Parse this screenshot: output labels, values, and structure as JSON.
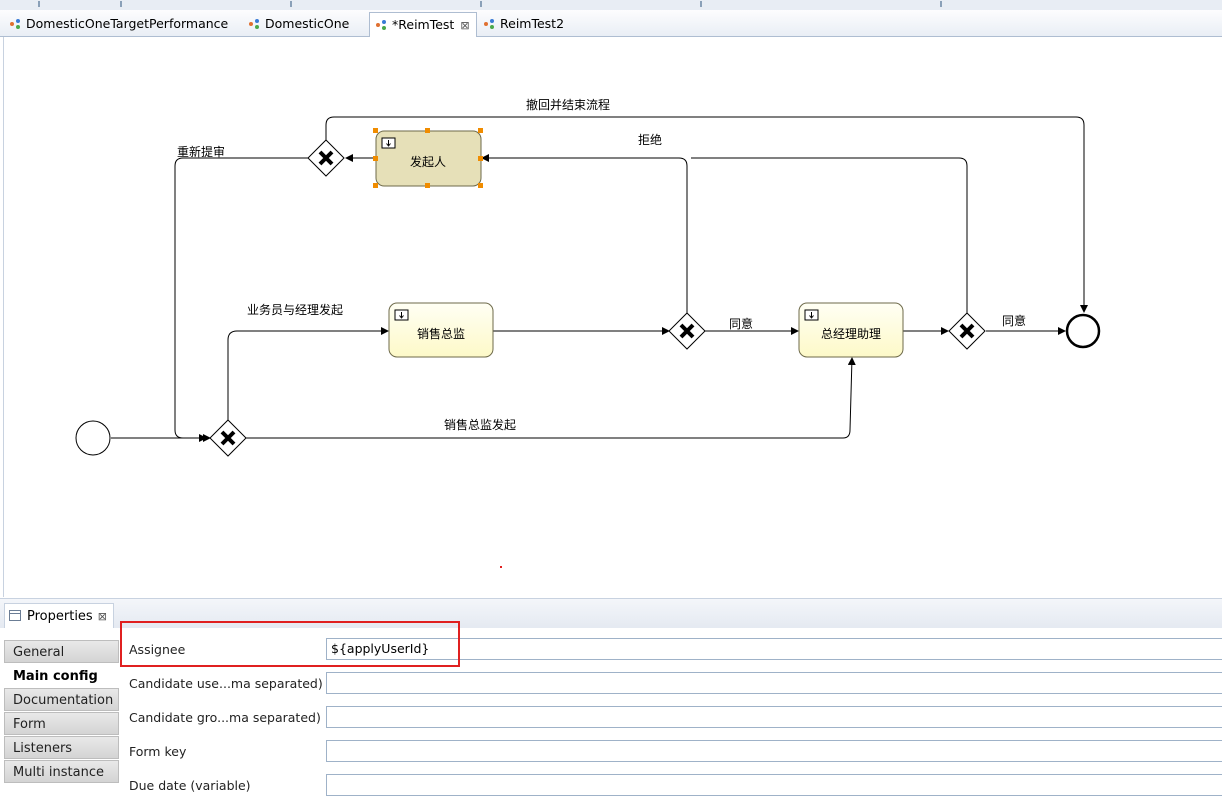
{
  "editor_tabs": [
    {
      "label": "DomesticOneTargetPerformance",
      "active": false
    },
    {
      "label": "DomesticOne",
      "active": false
    },
    {
      "label": "*ReimTest",
      "active": true,
      "close": "⊠"
    },
    {
      "label": "ReimTest2",
      "active": false
    }
  ],
  "diagram": {
    "tasks": {
      "initiator": "发起人",
      "sales_director": "销售总监",
      "gm_assistant": "总经理助理"
    },
    "flow_labels": {
      "withdraw_end": "撤回并结束流程",
      "reject": "拒绝",
      "resubmit": "重新提审",
      "staff_manager_initiate": "业务员与经理发起",
      "approve_1": "同意",
      "approve_2": "同意",
      "sales_director_initiate": "销售总监发起"
    }
  },
  "properties": {
    "title": "Properties",
    "close": "⊠",
    "side_tabs": [
      "General",
      "Main config",
      "Documentation",
      "Form",
      "Listeners",
      "Multi instance"
    ],
    "active_tab": "Main config",
    "fields": [
      {
        "label": "Assignee",
        "value": "${applyUserId}"
      },
      {
        "label": "Candidate use...ma separated)",
        "value": ""
      },
      {
        "label": "Candidate gro...ma separated)",
        "value": ""
      },
      {
        "label": "Form key",
        "value": ""
      },
      {
        "label": "Due date (variable)",
        "value": ""
      }
    ]
  },
  "colors": {
    "selected_task_fill": "#e6e0b8",
    "task_fill": "#fffde0",
    "selection_handle": "#f08c00",
    "highlight_box": "#e02020"
  }
}
